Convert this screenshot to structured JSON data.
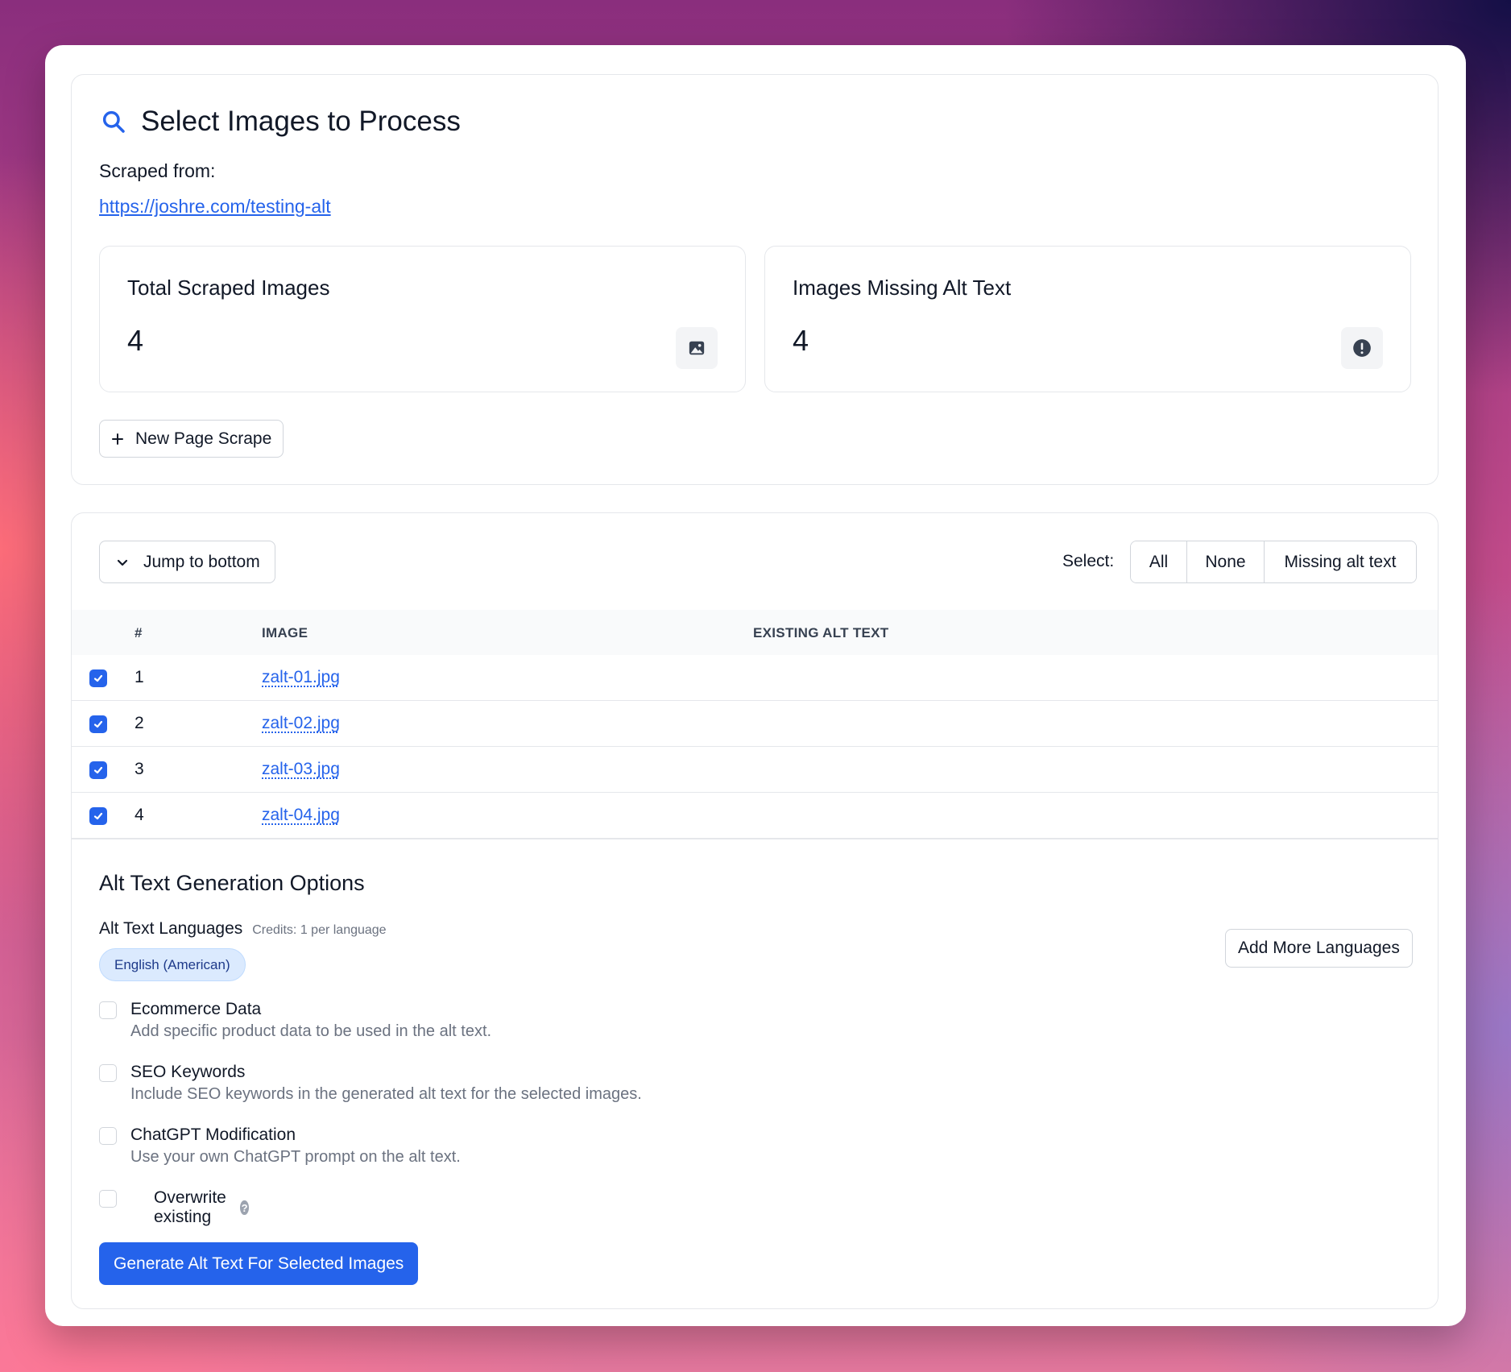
{
  "header": {
    "title": "Select Images to Process",
    "scraped_label": "Scraped from:",
    "scraped_url": "https://joshre.com/testing-alt"
  },
  "stats": [
    {
      "label": "Total Scraped Images",
      "value": "4",
      "icon": "image-icon"
    },
    {
      "label": "Images Missing Alt Text",
      "value": "4",
      "icon": "alert-circle-icon"
    }
  ],
  "actions": {
    "new_scrape_label": "New Page Scrape",
    "jump_label": "Jump to bottom"
  },
  "selection": {
    "label": "Select:",
    "options": [
      "All",
      "None",
      "Missing alt text"
    ]
  },
  "table": {
    "columns": [
      "#",
      "IMAGE",
      "EXISTING ALT TEXT"
    ],
    "rows": [
      {
        "num": "1",
        "file": "zalt-01.jpg",
        "alt": "",
        "checked": true
      },
      {
        "num": "2",
        "file": "zalt-02.jpg",
        "alt": "",
        "checked": true
      },
      {
        "num": "3",
        "file": "zalt-03.jpg",
        "alt": "",
        "checked": true
      },
      {
        "num": "4",
        "file": "zalt-04.jpg",
        "alt": "",
        "checked": true
      }
    ]
  },
  "options": {
    "title": "Alt Text Generation Options",
    "languages_label": "Alt Text Languages",
    "credits_note": "Credits: 1 per language",
    "selected_language": "English (American)",
    "add_languages_label": "Add More Languages",
    "items": [
      {
        "title": "Ecommerce Data",
        "desc": "Add specific product data to be used in the alt text.",
        "checked": false
      },
      {
        "title": "SEO Keywords",
        "desc": "Include SEO keywords in the generated alt text for the selected images.",
        "checked": false
      },
      {
        "title": "ChatGPT Modification",
        "desc": "Use your own ChatGPT prompt on the alt text.",
        "checked": false
      }
    ],
    "overwrite_label": "Overwrite existing",
    "overwrite_checked": false,
    "help_glyph": "?"
  },
  "generate_label": "Generate Alt Text For Selected Images",
  "colors": {
    "accent": "#2563eb",
    "chip_bg": "#dbeafe",
    "border": "#e5e7eb"
  }
}
